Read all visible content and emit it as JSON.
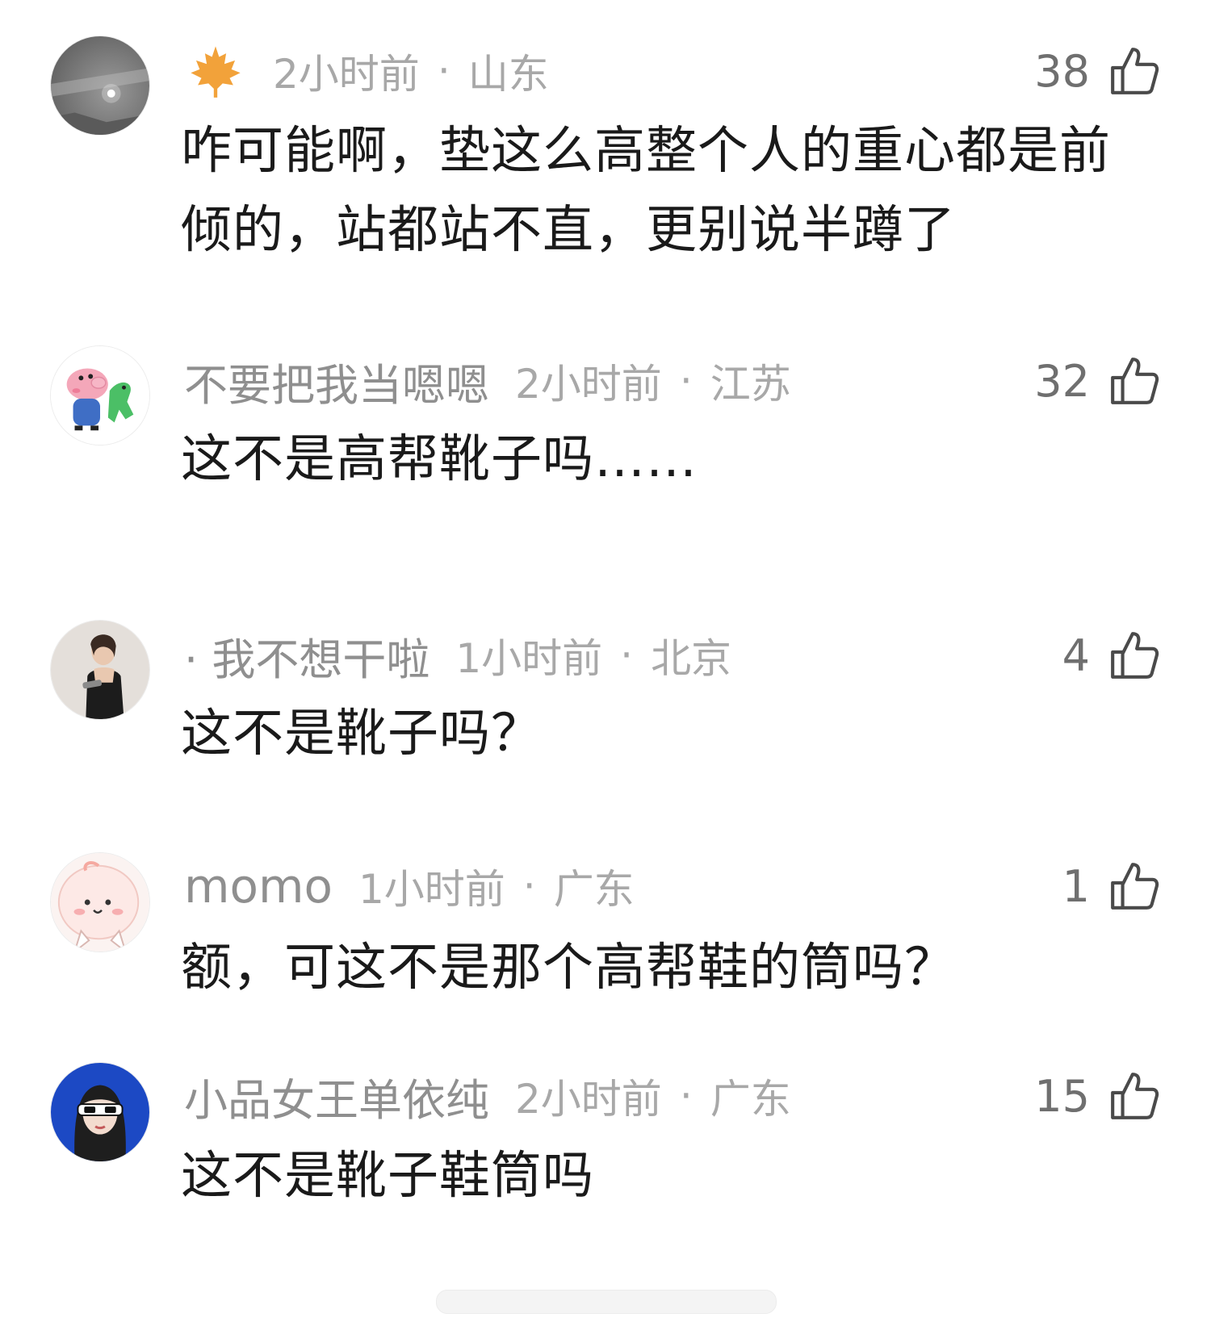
{
  "comments": [
    {
      "username": "",
      "badge_icon": "maple-leaf-icon",
      "time": "2小时前",
      "separator": "·",
      "region": "山东",
      "likes": "38",
      "text": "咋可能啊，垫这么高整个人的重心都是前倾的，站都站不直，更别说半蹲了"
    },
    {
      "username": "不要把我当嗯嗯",
      "time": "2小时前",
      "separator": "·",
      "region": "江苏",
      "likes": "32",
      "text": "这不是高帮靴子吗……"
    },
    {
      "username": "· 我不想干啦",
      "time": "1小时前",
      "separator": "·",
      "region": "北京",
      "likes": "4",
      "text": "这不是靴子吗？"
    },
    {
      "username": "momo",
      "time": "1小时前",
      "separator": "·",
      "region": "广东",
      "likes": "1",
      "text": "额，可这不是那个高帮鞋的筒吗？"
    },
    {
      "username": "小品女王单依纯",
      "time": "2小时前",
      "separator": "·",
      "region": "广东",
      "likes": "15",
      "text": "这不是靴子鞋筒吗"
    }
  ],
  "icons": {
    "like": "thumbs-up-icon"
  },
  "colors": {
    "body_text": "#1a1a1a",
    "meta_text": "#a8a8a8",
    "badge": "#f2a23a"
  }
}
